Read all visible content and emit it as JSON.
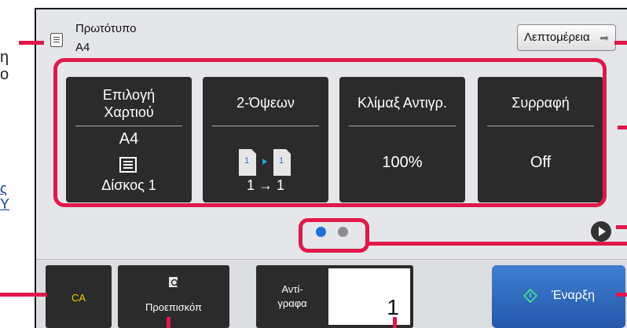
{
  "background_fragments": {
    "left_text": "η ο",
    "left_link": "ς Υ"
  },
  "header": {
    "original_label": "Πρωτότυπο",
    "original_size": "A4",
    "details_button": "Λεπτομέρεια"
  },
  "tiles": [
    {
      "title": "Επιλογή Χαρτιού",
      "value_top": "A4",
      "value_bottom": "Δίσκος 1",
      "icon": "paper-tray-icon"
    },
    {
      "title": "2-Όψεων",
      "value_bottom": "1 → 1",
      "icon": "duplex-icon"
    },
    {
      "title": "Κλίμαξ Αντιγρ.",
      "value": "100%"
    },
    {
      "title": "Συρραφή",
      "value": "Off"
    }
  ],
  "pagination": {
    "current": 1,
    "total": 2,
    "active_color": "#1f6fd8",
    "inactive_color": "#8c8c8c"
  },
  "footer": {
    "ca_label": "CA",
    "preview_label": "Προεπισκόπ",
    "copies_label": "Αντί-\nγραφα",
    "copies_value": "1",
    "start_label": "Έναρξη"
  },
  "colors": {
    "callout": "#e0184a",
    "tile_bg": "#2b2b2b",
    "start_bg": "#2f6cc1",
    "ca_text": "#f2d000"
  }
}
